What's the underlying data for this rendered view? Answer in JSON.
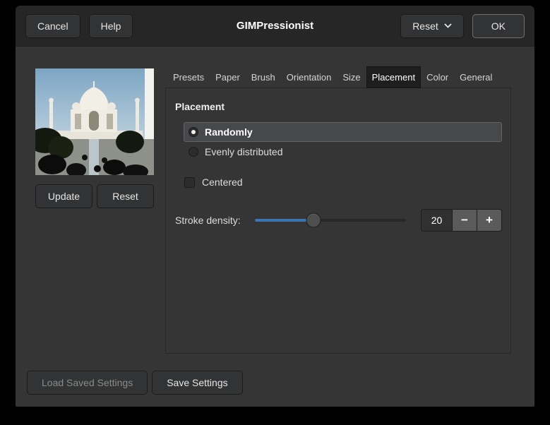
{
  "colors": {
    "accent_blue": "#3a76b0",
    "dialog_bg": "#353535",
    "header_bg": "#262626"
  },
  "header": {
    "title": "GIMPressionist",
    "cancel_label": "Cancel",
    "help_label": "Help",
    "reset_label": "Reset",
    "ok_label": "OK"
  },
  "preview": {
    "subject": "taj-mahal-photo-thumbnail",
    "update_label": "Update",
    "reset_label": "Reset"
  },
  "tabs": [
    {
      "label": "Presets",
      "active": false
    },
    {
      "label": "Paper",
      "active": false
    },
    {
      "label": "Brush",
      "active": false
    },
    {
      "label": "Orientation",
      "active": false
    },
    {
      "label": "Size",
      "active": false
    },
    {
      "label": "Placement",
      "active": true
    },
    {
      "label": "Color",
      "active": false
    },
    {
      "label": "General",
      "active": false
    }
  ],
  "placement": {
    "section_title": "Placement",
    "options": [
      {
        "label": "Randomly",
        "selected": true
      },
      {
        "label": "Evenly distributed",
        "selected": false
      }
    ],
    "centered": {
      "label": "Centered",
      "checked": false
    },
    "stroke_density": {
      "label": "Stroke density:",
      "value": "20",
      "minus_glyph": "−",
      "plus_glyph": "+"
    }
  },
  "footer": {
    "load_label": "Load Saved Settings",
    "load_enabled": false,
    "save_label": "Save Settings"
  }
}
